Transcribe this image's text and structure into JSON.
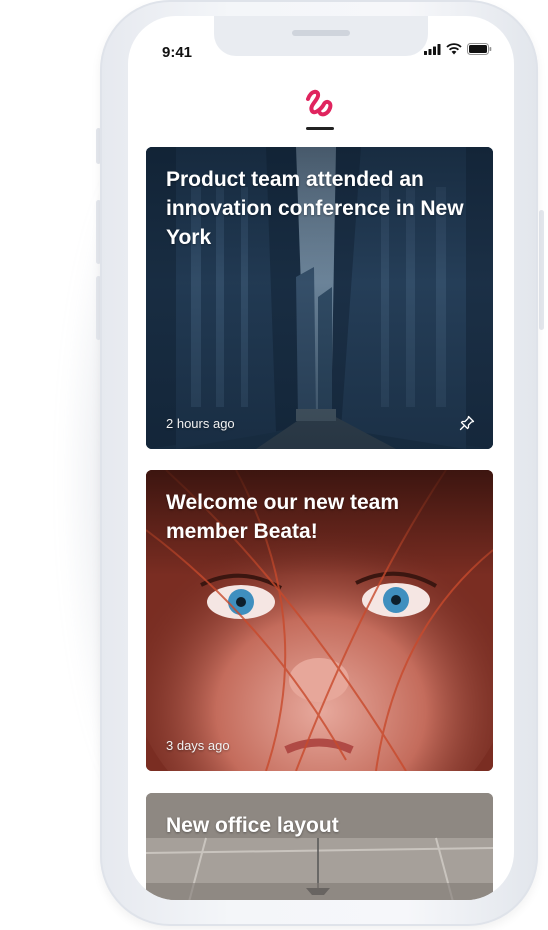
{
  "status_bar": {
    "time": "9:41",
    "icons": [
      "signal-icon",
      "wifi-icon",
      "battery-icon"
    ]
  },
  "brand": {
    "logo_icon": "wave-logo-icon",
    "accent_color": "#e0245e"
  },
  "feed": {
    "cards": [
      {
        "title": "Product team attended an innovation conference in New York",
        "time": "2 hours ago",
        "pinned": true,
        "image": "city-street"
      },
      {
        "title": "Welcome our new team member Beata!",
        "time": "3 days ago",
        "pinned": false,
        "image": "portrait"
      },
      {
        "title": "New office layout",
        "time": "",
        "pinned": false,
        "image": "office-interior"
      }
    ]
  }
}
